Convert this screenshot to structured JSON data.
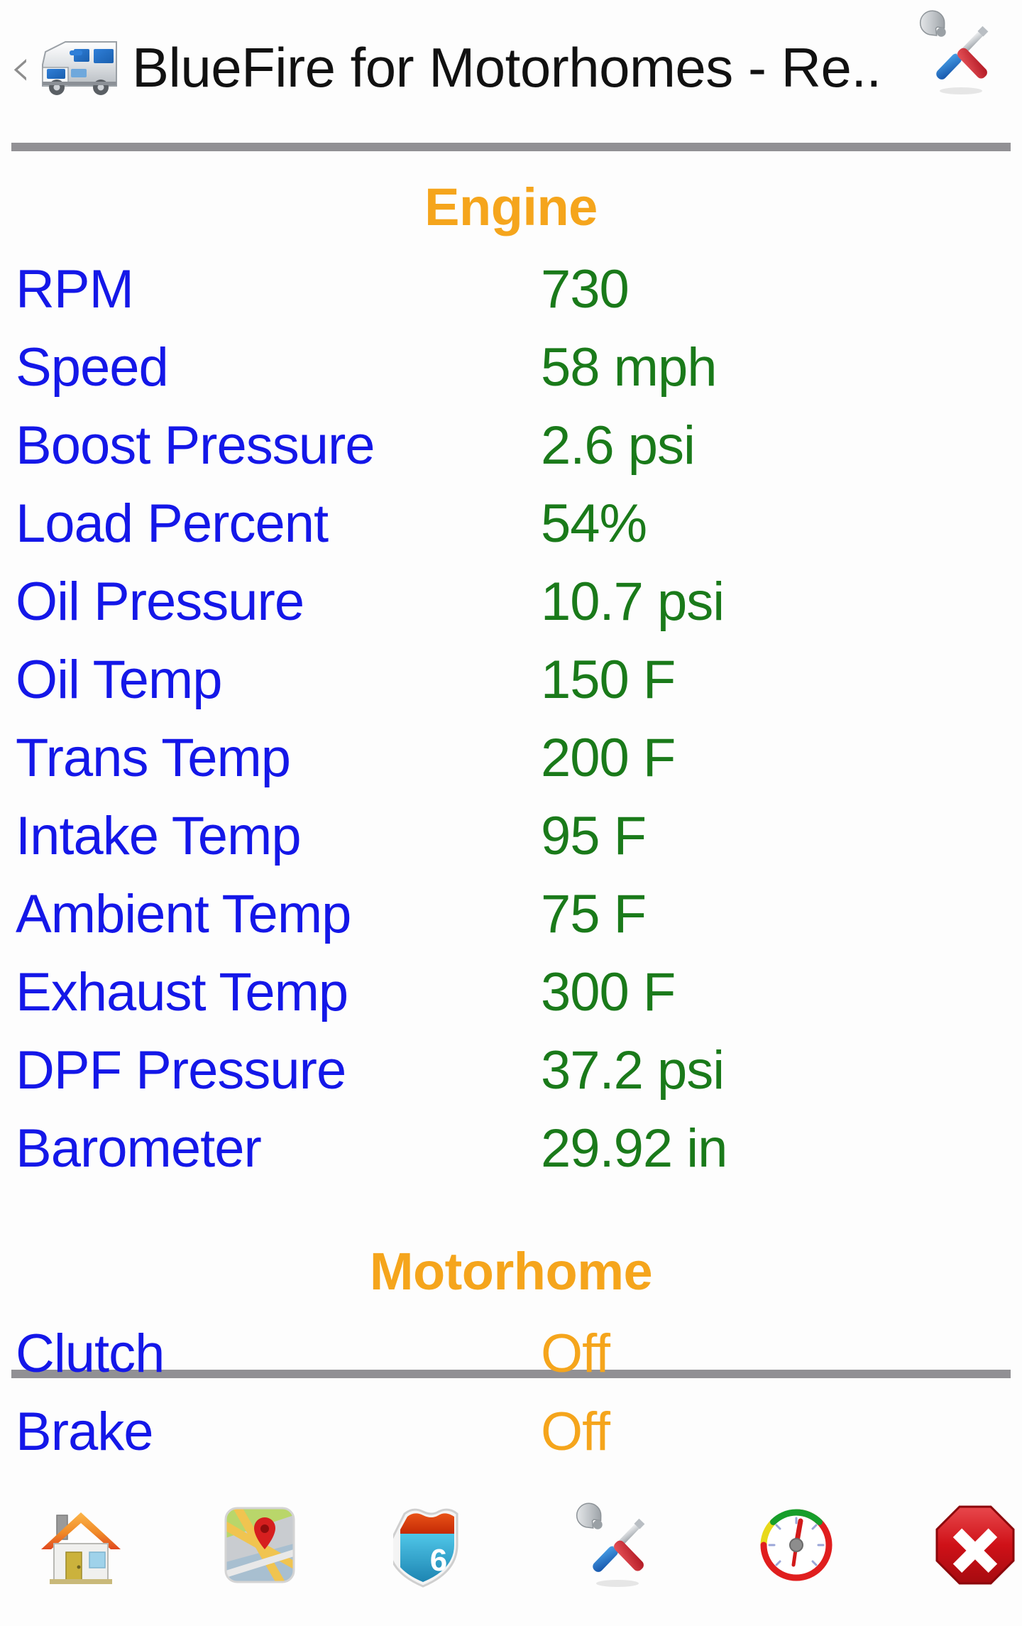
{
  "header": {
    "back_label": "‹",
    "back_icon": "back-chevron-icon",
    "app_icon": "motorhome-rv-icon",
    "title": "BlueFire for Motorhomes - Re..",
    "action_icon": "tools-icon"
  },
  "sections": [
    {
      "title": "Engine",
      "rows": [
        {
          "label": "RPM",
          "value": "730",
          "value_color": "green"
        },
        {
          "label": "Speed",
          "value": "58 mph",
          "value_color": "green"
        },
        {
          "label": "Boost Pressure",
          "value": "2.6 psi",
          "value_color": "green"
        },
        {
          "label": "Load Percent",
          "value": "54%",
          "value_color": "green"
        },
        {
          "label": "Oil Pressure",
          "value": "10.7 psi",
          "value_color": "green"
        },
        {
          "label": "Oil Temp",
          "value": "150 F",
          "value_color": "green"
        },
        {
          "label": "Trans Temp",
          "value": "200 F",
          "value_color": "green"
        },
        {
          "label": "Intake Temp",
          "value": "95 F",
          "value_color": "green"
        },
        {
          "label": "Ambient Temp",
          "value": "75 F",
          "value_color": "green"
        },
        {
          "label": "Exhaust Temp",
          "value": "300 F",
          "value_color": "green"
        },
        {
          "label": "DPF Pressure",
          "value": "37.2 psi",
          "value_color": "green"
        },
        {
          "label": "Barometer",
          "value": "29.92 in",
          "value_color": "green"
        }
      ]
    },
    {
      "title": "Motorhome",
      "rows": [
        {
          "label": "Clutch",
          "value": "Off",
          "value_color": "orange"
        },
        {
          "label": "Brake",
          "value": "Off",
          "value_color": "orange"
        }
      ]
    }
  ],
  "navbar": {
    "items": [
      {
        "icon": "home-icon",
        "name": "nav-home"
      },
      {
        "icon": "map-icon",
        "name": "nav-map"
      },
      {
        "icon": "highway-shield-icon",
        "shield_number": "6",
        "name": "nav-highway"
      },
      {
        "icon": "tools-icon",
        "name": "nav-tools"
      },
      {
        "icon": "gauge-icon",
        "name": "nav-gauge"
      },
      {
        "icon": "stop-x-icon",
        "name": "nav-stop"
      }
    ]
  },
  "colors": {
    "label": "#1417e8",
    "value_green": "#1a7a1a",
    "value_orange": "#f5a51c",
    "section_title": "#f5a51c",
    "separator": "#919094",
    "background": "#fdfdfd"
  }
}
